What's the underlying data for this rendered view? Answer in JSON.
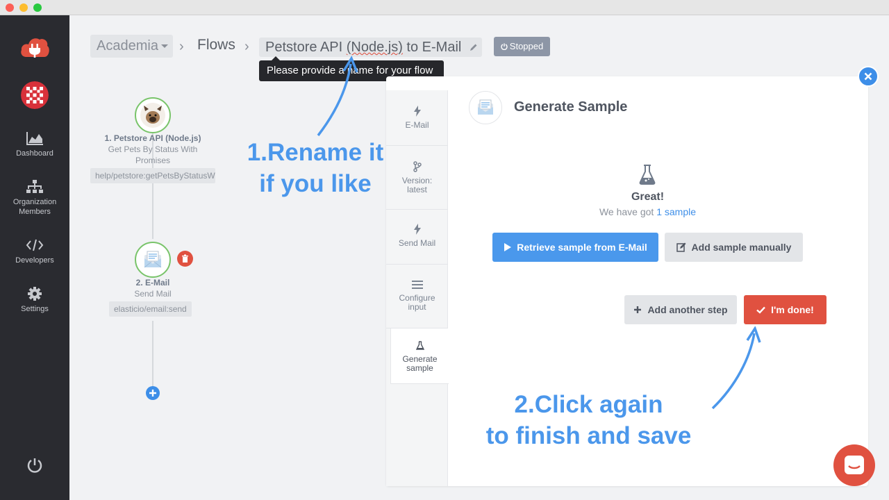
{
  "window": {
    "buttons": [
      "close",
      "minimize",
      "zoom"
    ]
  },
  "sidebar": {
    "items": [
      {
        "label": "Dashboard",
        "icon": "chart-area-icon"
      },
      {
        "label": "Organization Members",
        "label_lines": [
          "Organization",
          "Members"
        ],
        "icon": "org-chart-icon"
      },
      {
        "label": "Developers",
        "icon": "code-icon"
      },
      {
        "label": "Settings",
        "icon": "gear-icon"
      }
    ]
  },
  "breadcrumb": {
    "workspace": "Academia",
    "flows": "Flows",
    "flow_name_pre": "Petstore API ",
    "flow_name_misspelled": "(Node.js)",
    "flow_name_post": " to E-Mail",
    "status": "Stopped"
  },
  "tooltip": {
    "text": "Please provide a name for your flow"
  },
  "flow": {
    "nodes": [
      {
        "title": "1. Petstore API (Node.js)",
        "subtitle_lines": [
          "Get Pets By Status With",
          "Promises"
        ],
        "path": "help/petstore:getPetsByStatusW"
      },
      {
        "title": "2. E-Mail",
        "subtitle": "Send Mail",
        "path": "elasticio/email:send"
      }
    ]
  },
  "annotations": {
    "rename": [
      "1.Rename it",
      "if you like"
    ],
    "finish": [
      "2.Click again",
      "to finish and save"
    ]
  },
  "tabs": [
    {
      "label_lines": [
        "E-Mail"
      ],
      "icon": "bolt-icon"
    },
    {
      "label_lines": [
        "Version:",
        "latest"
      ],
      "icon": "branch-icon"
    },
    {
      "label_lines": [
        "Send Mail"
      ],
      "icon": "bolt-icon"
    },
    {
      "label_lines": [
        "Configure",
        "input"
      ],
      "icon": "list-icon"
    },
    {
      "label_lines": [
        "Generate",
        "sample"
      ],
      "icon": "flask-icon",
      "active": true
    }
  ],
  "sample": {
    "title": "Generate Sample",
    "great": "Great!",
    "got_prefix": "We have got ",
    "got_link": "1 sample",
    "retrieve_button": "Retrieve sample from E-Mail",
    "manual_button": "Add sample manually",
    "add_step_button": "Add another step",
    "done_button": "I'm done!"
  },
  "colors": {
    "accent": "#4a98ec",
    "danger": "#e05140",
    "sidebar": "#2a2b30",
    "success": "#79c46a"
  }
}
